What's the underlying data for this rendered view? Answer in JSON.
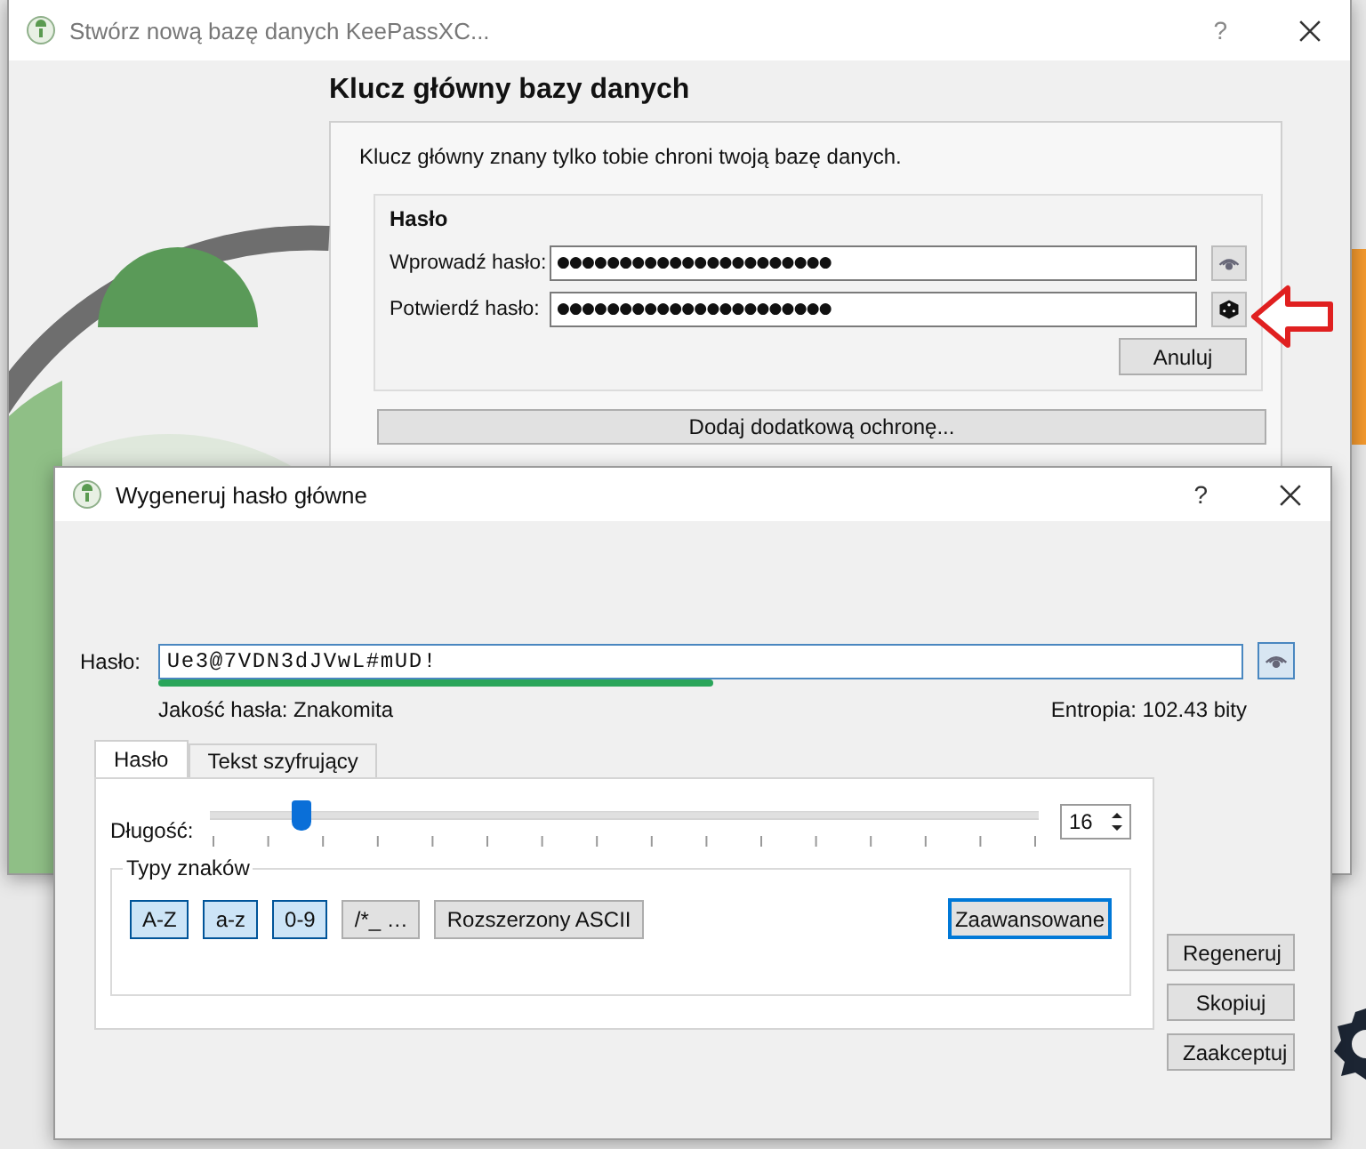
{
  "background_window": {
    "title": "Stwórz nową bazę danych KeePassXC...",
    "help": "?",
    "heading": "Klucz główny bazy danych",
    "description": "Klucz główny znany tylko tobie chroni twoją bazę danych.",
    "password_group": {
      "title": "Hasło",
      "fields": [
        {
          "label": "Wprowadź hasło:",
          "value": "●●●●●●●●●●●●●●●●●●●●●●",
          "kind": "eye"
        },
        {
          "label": "Potwierdź hasło:",
          "value": "●●●●●●●●●●●●●●●●●●●●●●",
          "kind": "dice"
        }
      ],
      "cancel": "Anuluj"
    },
    "add_protection": "Dodaj dodatkową ochronę..."
  },
  "dialog": {
    "title": "Wygeneruj hasło główne",
    "help": "?",
    "password": {
      "label": "Hasło:",
      "value": "Ue3@7VDN3dJVwL#mUD!",
      "quality_bar": {
        "level": 0.51
      },
      "quality": "Jakość hasła: Znakomita",
      "entropy": "Entropia: 102.43 bity"
    },
    "tabs": [
      {
        "label": "Hasło",
        "selected": true
      },
      {
        "label": "Tekst szyfrujący",
        "selected": false
      }
    ],
    "length": {
      "label": "Długość:",
      "slider": {
        "level": 0.11
      },
      "value": "16"
    },
    "char_types": {
      "title": "Typy znaków",
      "buttons": [
        {
          "label": "A-Z",
          "selected": true
        },
        {
          "label": "a-z",
          "selected": true
        },
        {
          "label": "0-9",
          "selected": true
        },
        {
          "label": "/*_ …",
          "selected": false
        },
        {
          "label": "Rozszerzony ASCII",
          "selected": false
        }
      ],
      "advanced": {
        "label": "Zaawansowane",
        "focused": true
      }
    },
    "actions": [
      "Regeneruj",
      "Skopiuj",
      "Zaakceptuj"
    ]
  }
}
